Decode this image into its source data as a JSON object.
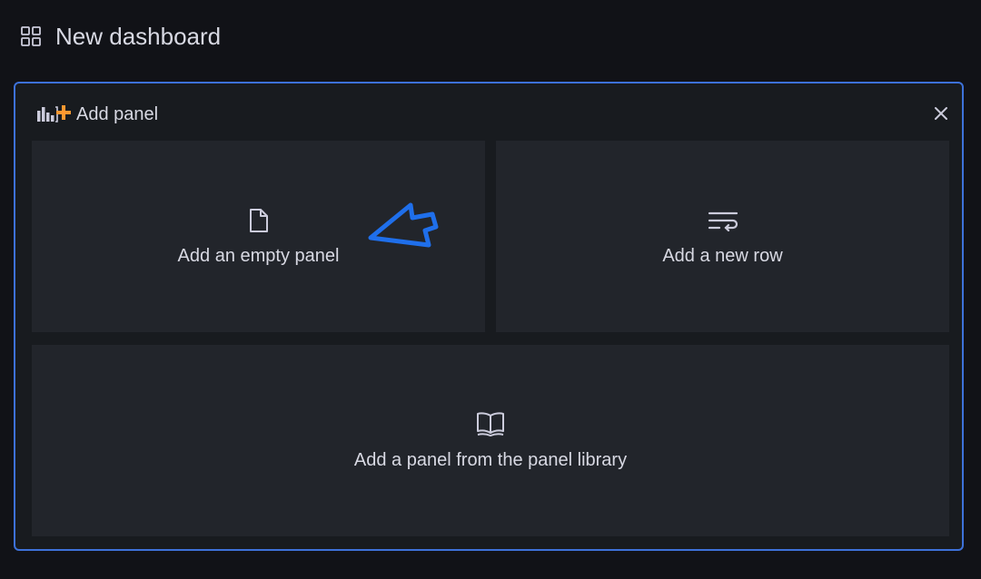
{
  "dashboard": {
    "title": "New dashboard",
    "icon": "dashboard-grid-icon"
  },
  "add_panel": {
    "title": "Add panel",
    "icon": "add-panel-icon",
    "close_icon": "close-icon",
    "accent_color": "#3d71d9",
    "icon_accent_color": "#ff9830",
    "options": [
      {
        "label": "Add an empty panel",
        "icon": "file-icon"
      },
      {
        "label": "Add a new row",
        "icon": "row-wrap-icon"
      },
      {
        "label": "Add a panel from the panel library",
        "icon": "book-icon"
      }
    ]
  },
  "annotation": {
    "icon": "pointer-arrow-icon",
    "color": "#1f6feb"
  }
}
